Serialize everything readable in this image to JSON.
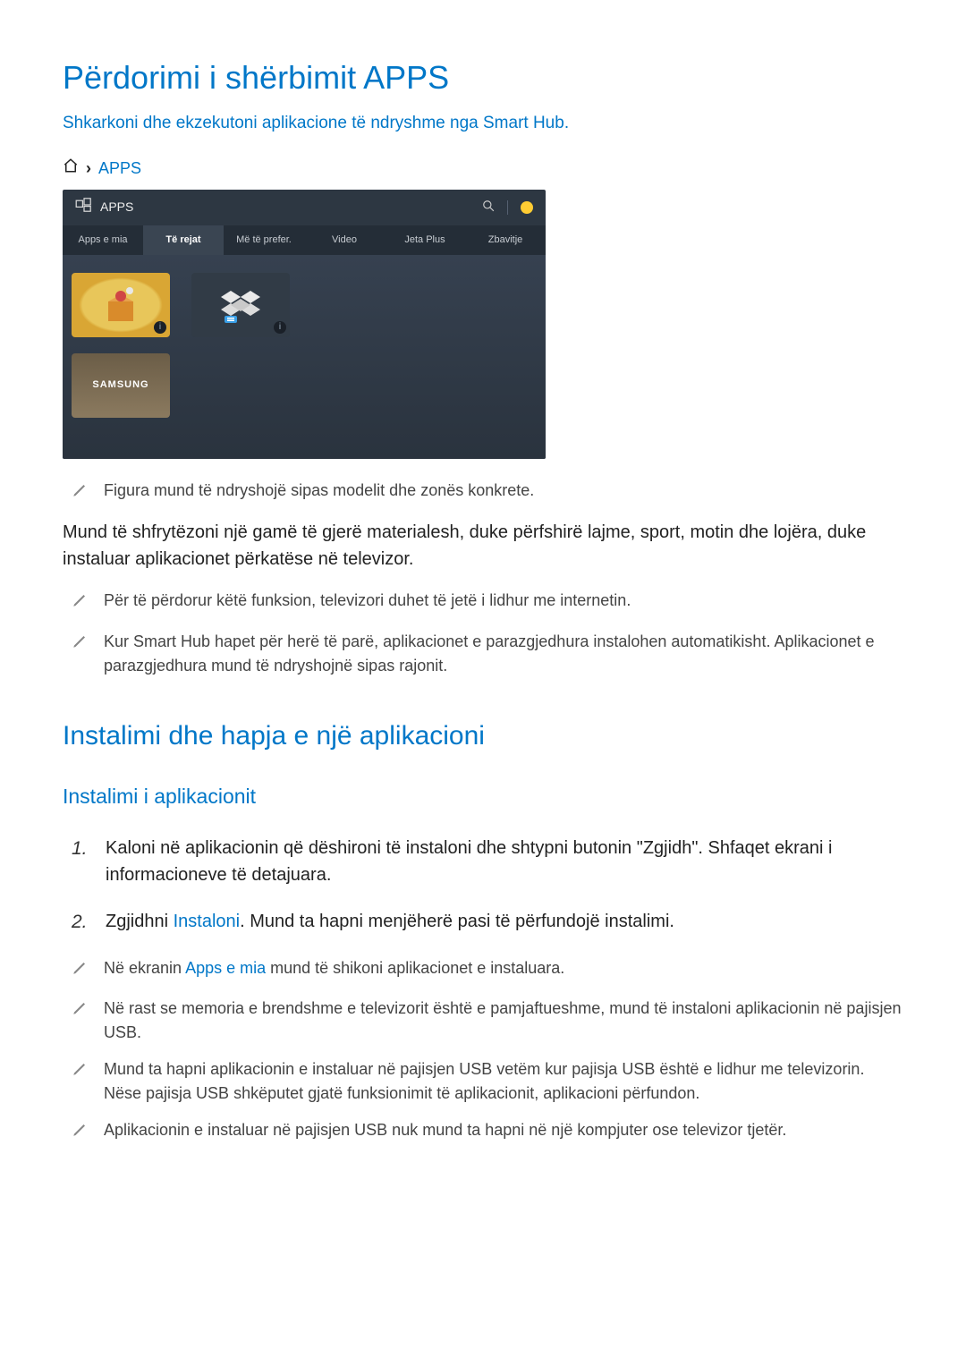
{
  "title": "Përdorimi i shërbimit APPS",
  "subtitle": "Shkarkoni dhe ekzekutoni aplikacione të ndryshme nga Smart Hub.",
  "breadcrumb": {
    "apps": "APPS"
  },
  "tv": {
    "header_label": "APPS",
    "tabs": [
      "Apps e mia",
      "Të rejat",
      "Më të prefer.",
      "Video",
      "Jeta Plus",
      "Zbavitje"
    ],
    "samsung_label": "SAMSUNG"
  },
  "note1": "Figura mund të ndryshojë sipas modelit dhe zonës konkrete.",
  "body1": "Mund të shfrytëzoni një gamë të gjerë materialesh, duke përfshirë lajme, sport, motin dhe lojëra, duke instaluar aplikacionet përkatëse në televizor.",
  "note2": "Për të përdorur këtë funksion, televizori duhet të jetë i lidhur me internetin.",
  "note3": "Kur Smart Hub hapet për herë të parë, aplikacionet e parazgjedhura instalohen automatikisht. Aplikacionet e parazgjedhura mund të ndryshojnë sipas rajonit.",
  "h2": "Instalimi dhe hapja e një aplikacioni",
  "h3": "Instalimi i aplikacionit",
  "step1": "Kaloni në aplikacionin që dëshironi të instaloni dhe shtypni butonin \"Zgjidh\". Shfaqet ekrani i informacioneve të detajuara.",
  "step2_pre": "Zgjidhni ",
  "step2_link": "Instaloni",
  "step2_post": ". Mund ta hapni menjëherë pasi të përfundojë instalimi.",
  "note4_pre": "Në ekranin ",
  "note4_link": "Apps e mia",
  "note4_post": " mund të shikoni aplikacionet e instaluara.",
  "note5": "Në rast se memoria e brendshme e televizorit është e pamjaftueshme, mund të instaloni aplikacionin në pajisjen USB.",
  "note6": "Mund ta hapni aplikacionin e instaluar në pajisjen USB vetëm kur pajisja USB është e lidhur me televizorin. Nëse pajisja USB shkëputet gjatë funksionimit të aplikacionit, aplikacioni përfundon.",
  "note7": "Aplikacionin e instaluar në pajisjen USB nuk mund ta hapni në një kompjuter ose televizor tjetër."
}
